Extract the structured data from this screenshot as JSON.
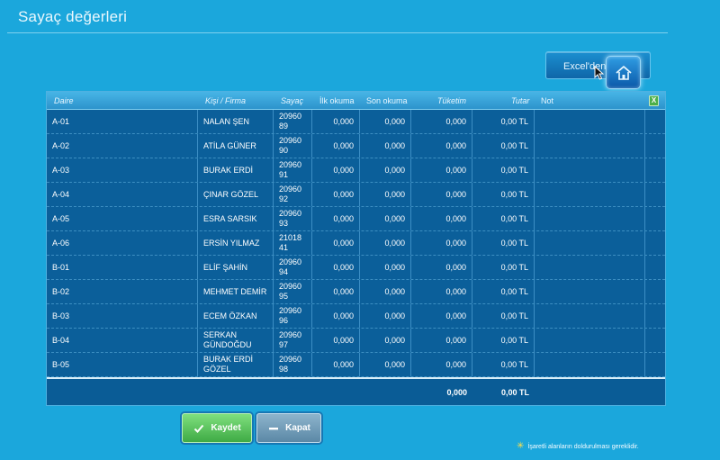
{
  "page": {
    "title": "Sayaç değerleri",
    "excel_button_label": "Excel'den y",
    "required_note": "İşaretli alanların doldurulması gereklidir."
  },
  "grid": {
    "headers": {
      "daire": "Daire",
      "kisi": "Kişi / Firma",
      "sayac": "Sayaç",
      "ilk": "İlk okuma",
      "son": "Son okuma",
      "tuketim": "Tüketim",
      "tutar": "Tutar",
      "not": "Not"
    },
    "excel_icon_label": "X",
    "rows": [
      {
        "daire": "A-01",
        "kisi": "NALAN ŞEN",
        "sayac": "20960 89",
        "ilk": "0,000",
        "son": "0,000",
        "tuketim": "0,000",
        "tutar": "0,00 TL",
        "not": ""
      },
      {
        "daire": "A-02",
        "kisi": "ATİLA GÜNER",
        "sayac": "20960 90",
        "ilk": "0,000",
        "son": "0,000",
        "tuketim": "0,000",
        "tutar": "0,00 TL",
        "not": ""
      },
      {
        "daire": "A-03",
        "kisi": "BURAK ERDİ",
        "sayac": "20960 91",
        "ilk": "0,000",
        "son": "0,000",
        "tuketim": "0,000",
        "tutar": "0,00 TL",
        "not": ""
      },
      {
        "daire": "A-04",
        "kisi": "ÇINAR GÖZEL",
        "sayac": "20960 92",
        "ilk": "0,000",
        "son": "0,000",
        "tuketim": "0,000",
        "tutar": "0,00 TL",
        "not": ""
      },
      {
        "daire": "A-05",
        "kisi": "ESRA SARSIK",
        "sayac": "20960 93",
        "ilk": "0,000",
        "son": "0,000",
        "tuketim": "0,000",
        "tutar": "0,00 TL",
        "not": ""
      },
      {
        "daire": "A-06",
        "kisi": "ERSİN YILMAZ",
        "sayac": "21018 41",
        "ilk": "0,000",
        "son": "0,000",
        "tuketim": "0,000",
        "tutar": "0,00 TL",
        "not": ""
      },
      {
        "daire": "B-01",
        "kisi": "ELİF ŞAHİN",
        "sayac": "20960 94",
        "ilk": "0,000",
        "son": "0,000",
        "tuketim": "0,000",
        "tutar": "0,00 TL",
        "not": ""
      },
      {
        "daire": "B-02",
        "kisi": "MEHMET DEMİR",
        "sayac": "20960 95",
        "ilk": "0,000",
        "son": "0,000",
        "tuketim": "0,000",
        "tutar": "0,00 TL",
        "not": ""
      },
      {
        "daire": "B-03",
        "kisi": "ECEM ÖZKAN",
        "sayac": "20960 96",
        "ilk": "0,000",
        "son": "0,000",
        "tuketim": "0,000",
        "tutar": "0,00 TL",
        "not": ""
      },
      {
        "daire": "B-04",
        "kisi": "SERKAN GÜNDOĞDU",
        "sayac": "20960 97",
        "ilk": "0,000",
        "son": "0,000",
        "tuketim": "0,000",
        "tutar": "0,00 TL",
        "not": ""
      },
      {
        "daire": "B-05",
        "kisi": "BURAK ERDİ GÖZEL",
        "sayac": "20960 98",
        "ilk": "0,000",
        "son": "0,000",
        "tuketim": "0,000",
        "tutar": "0,00 TL",
        "not": ""
      }
    ],
    "totals": {
      "tuketim": "0,000",
      "tutar": "0,00 TL"
    }
  },
  "buttons": {
    "save_label": "Kaydet",
    "close_label": "Kapat"
  },
  "colors": {
    "background": "#1ba7dc",
    "grid": "#0b5f9a",
    "save": "#4fbf52",
    "star": "#ffe04a"
  },
  "icons": {
    "home": "home-icon",
    "save": "check-icon",
    "close": "minus-icon",
    "excel": "excel-icon",
    "required": "star-icon"
  }
}
